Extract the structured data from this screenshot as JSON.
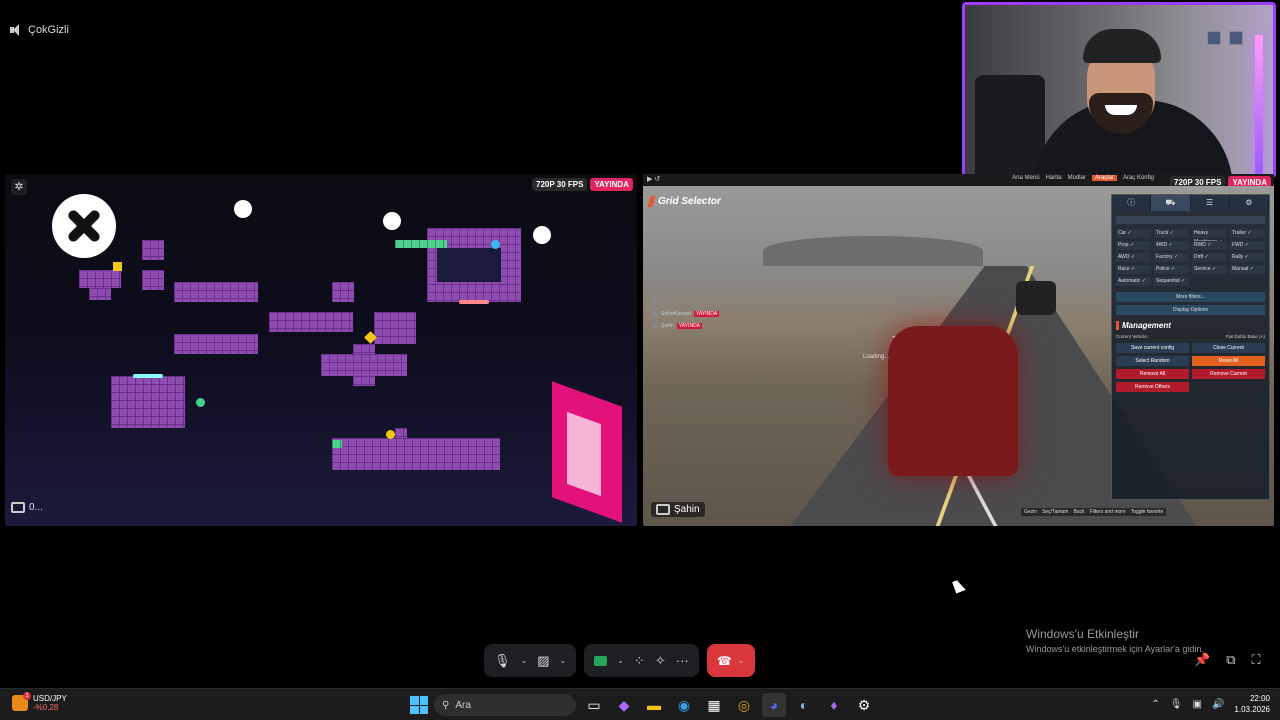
{
  "voice": {
    "channel_name": "ÇokGizli"
  },
  "left_stream": {
    "quality_badge": "720P 30 FPS",
    "live_badge": "YAYINDA",
    "user_label": "0..."
  },
  "right_stream": {
    "quality_badge": "720P 30 FPS",
    "live_badge": "YAYINDA",
    "user_label": "Şahin",
    "game": {
      "nav_items": [
        "Ana Menü",
        "Harita",
        "Modlar",
        "Araçlar",
        "Araç Konfig"
      ],
      "active_nav": "Araçlar",
      "title": "Grid Selector",
      "loading_text": "Loading...",
      "players": [
        {
          "name": "...",
          "tag": ""
        },
        {
          "name": "SeiferKarayel",
          "tag": "YAYINDA"
        },
        {
          "name": "Şahin",
          "tag": "YAYINDA"
        }
      ],
      "filters": [
        "Car ✓",
        "Truck ✓",
        "Heavy Machinery ✓",
        "Trailer ✓",
        "Prop ✓",
        "4WD ✓",
        "RWD ✓",
        "FWD ✓",
        "AWD ✓",
        "Factory ✓",
        "Drift ✓",
        "Rally ✓",
        "Race ✓",
        "Police ✓",
        "Service ✓",
        "Manual ✓",
        "Automatic ✓",
        "Sequential ✓"
      ],
      "more_filters": "More filters...",
      "display_options": "Display Options",
      "management_title": "Management",
      "current_vehicle_label": "Current Vehicle:",
      "current_vehicle_value": "Fiat Doblo Base (A)",
      "buttons": {
        "save_config": "Save current config",
        "close_current": "Close Current",
        "select_random": "Select Random",
        "reset_all": "Reset All",
        "remove_all": "Remove All",
        "remove_current": "Remove Current",
        "remove_others": "Remove Others"
      },
      "hints": [
        "Gezin",
        "Seç/Tamam",
        "Back",
        "Filters and more",
        "Toggle favorite"
      ]
    }
  },
  "watermark": {
    "line1": "Windows'u Etkinleştir",
    "line2": "Windows'u etkinleştirmek için Ayarlar'a gidin."
  },
  "taskbar": {
    "stock_name": "USD/JPY",
    "stock_change": "-%0,28",
    "search_placeholder": "Ara",
    "time": "22:00",
    "date": "1.03.2026"
  },
  "colors": {
    "hangup": "#da373c",
    "live": "#e0245e",
    "accent_orange": "#e35a2f",
    "webcam_border": "#9b3cff"
  }
}
